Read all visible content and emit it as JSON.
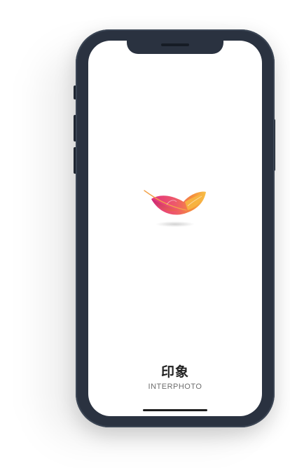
{
  "splash": {
    "app_name": "印象",
    "app_subtitle": "INTERPHOTO",
    "logo_icon": "feather-icon"
  },
  "colors": {
    "device_frame": "#2a3240",
    "screen_background": "#ffffff",
    "feather_magenta": "#e33a8d",
    "feather_orange": "#f58d3b",
    "feather_yellow": "#f7c24a",
    "title_text": "#232323",
    "subtitle_text": "#6e6e6e"
  }
}
